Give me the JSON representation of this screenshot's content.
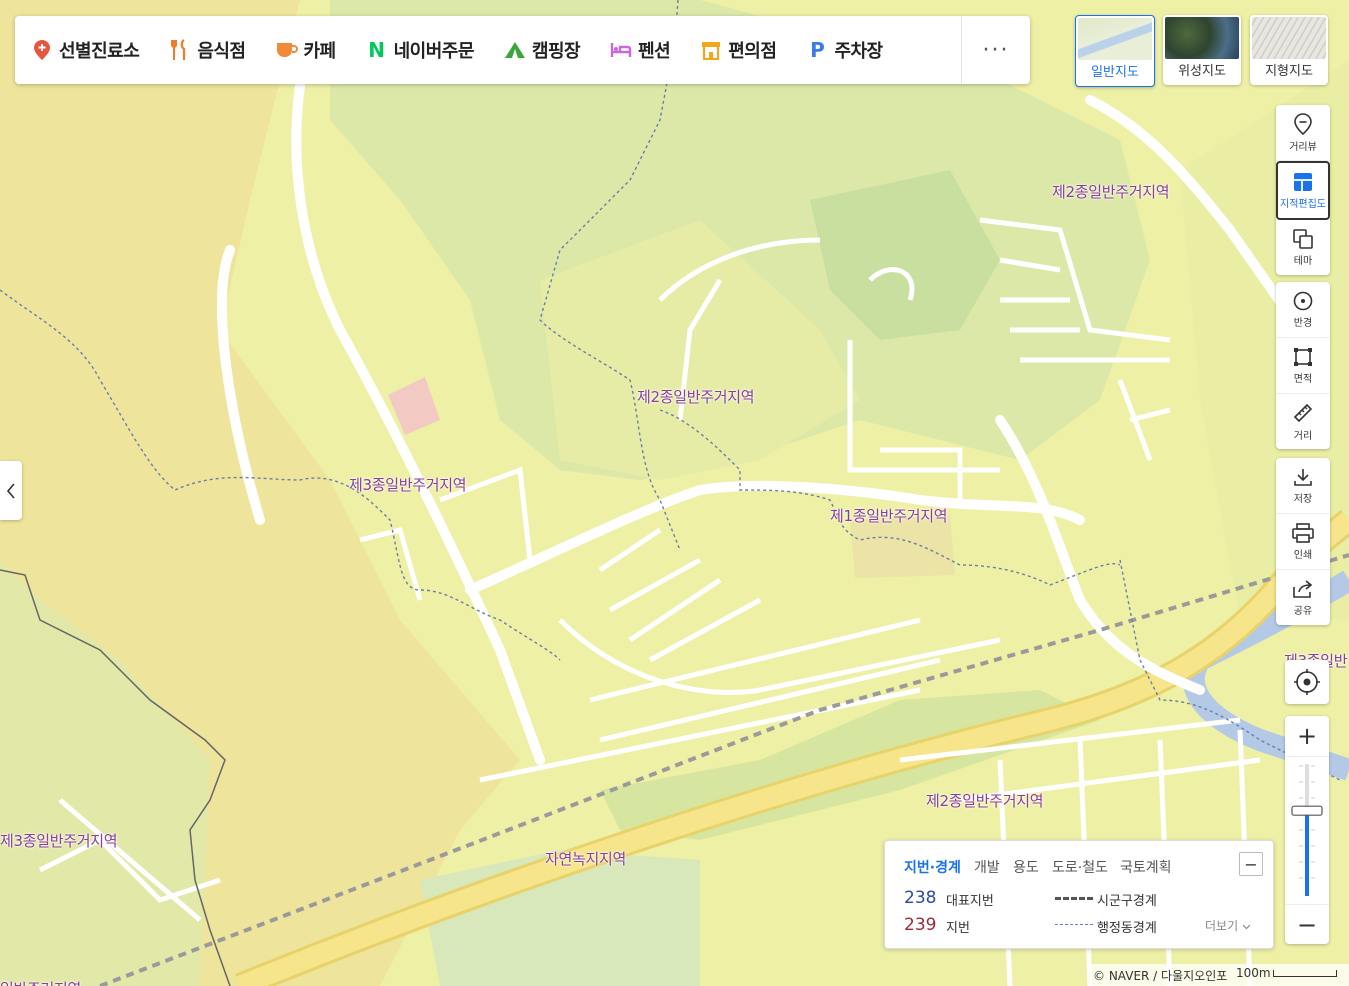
{
  "category_bar": {
    "items": [
      {
        "label": "선별진료소",
        "icon": "clinic-pin-icon",
        "color": "#e8553f"
      },
      {
        "label": "음식점",
        "icon": "fork-knife-icon",
        "color": "#f27b2a"
      },
      {
        "label": "카페",
        "icon": "coffee-cup-icon",
        "color": "#f28a3a"
      },
      {
        "label": "네이버주문",
        "icon": "naver-n-icon",
        "color": "#03c75a"
      },
      {
        "label": "캠핑장",
        "icon": "tent-icon",
        "color": "#3aa63a"
      },
      {
        "label": "펜션",
        "icon": "bed-icon",
        "color": "#c76ad8"
      },
      {
        "label": "편의점",
        "icon": "store-icon",
        "color": "#f2a81d"
      },
      {
        "label": "주차장",
        "icon": "parking-p-icon",
        "color": "#3b7be8"
      }
    ],
    "more_label": "···"
  },
  "map_types": [
    {
      "label": "일반지도",
      "active": true
    },
    {
      "label": "위성지도",
      "active": false
    },
    {
      "label": "지형지도",
      "active": false
    }
  ],
  "tools_group1": [
    {
      "label": "거리뷰",
      "icon": "street-view-icon"
    },
    {
      "label": "지적편집도",
      "icon": "cadastral-map-icon",
      "active": true
    },
    {
      "label": "테마",
      "icon": "theme-layers-icon"
    }
  ],
  "tools_group2": [
    {
      "label": "반경",
      "icon": "radius-icon"
    },
    {
      "label": "면적",
      "icon": "area-icon"
    },
    {
      "label": "거리",
      "icon": "ruler-icon"
    }
  ],
  "tools_group3": [
    {
      "label": "저장",
      "icon": "download-icon"
    },
    {
      "label": "인쇄",
      "icon": "printer-icon"
    },
    {
      "label": "공유",
      "icon": "share-icon"
    }
  ],
  "zoom": {
    "in_label": "+",
    "out_label": "−",
    "level_fraction": 0.35
  },
  "zone_labels": [
    {
      "text": "제2종일반주거지역"
    },
    {
      "text": "제2종일반주거지역"
    },
    {
      "text": "제3종일반주거지역"
    },
    {
      "text": "제1종일반주거지역"
    },
    {
      "text": "제3종일반"
    },
    {
      "text": "제2종일반주거지역"
    },
    {
      "text": "제3종일반주거지역"
    },
    {
      "text": "자연녹지지역"
    },
    {
      "text": "일반주거지역"
    }
  ],
  "legend": {
    "tabs": [
      "지번·경계",
      "개발",
      "용도",
      "도로·철도",
      "국토계획"
    ],
    "collapse_label": "−",
    "rep_num": "238",
    "rep_label": "대표지번",
    "lot_num": "239",
    "lot_label": "지번",
    "city_boundary": "시군구경계",
    "dong_boundary": "행정동경계",
    "more_label": "더보기",
    "colors": {
      "rep": "#2b4aa8",
      "lot": "#9c2a3a",
      "city": "#555555",
      "dong": "#4a8ad8"
    }
  },
  "attribution": {
    "text": "© NAVER / 다울지오인포",
    "scale_label": "100m"
  },
  "colors": {
    "accent": "#1a73e8",
    "residential2": "#eef0a6",
    "residential3": "#f0e49a",
    "green": "#d3e6a4"
  }
}
